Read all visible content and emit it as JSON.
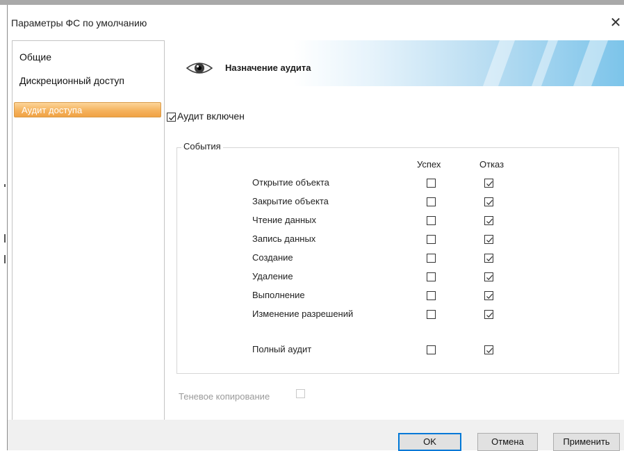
{
  "window": {
    "title": "Параметры ФС по умолчанию",
    "close_symbol": "✕"
  },
  "sidebar": {
    "items": [
      {
        "label": "Общие"
      },
      {
        "label": "Дискреционный доступ"
      },
      {
        "label": "Аудит доступа",
        "selected": true
      }
    ]
  },
  "banner": {
    "title": "Назначение аудита",
    "icon": "eye-icon"
  },
  "audit_enabled": {
    "label": "Аудит включен",
    "checked": true
  },
  "events": {
    "title": "События",
    "columns": {
      "success": "Успех",
      "failure": "Отказ"
    },
    "rows": [
      {
        "label": "Открытие объекта",
        "success": false,
        "failure": true
      },
      {
        "label": "Закрытие объекта",
        "success": false,
        "failure": true
      },
      {
        "label": "Чтение данных",
        "success": false,
        "failure": true
      },
      {
        "label": "Запись данных",
        "success": false,
        "failure": true
      },
      {
        "label": "Создание",
        "success": false,
        "failure": true
      },
      {
        "label": "Удаление",
        "success": false,
        "failure": true
      },
      {
        "label": "Выполнение",
        "success": false,
        "failure": true
      },
      {
        "label": "Изменение разрешений",
        "success": false,
        "failure": true
      }
    ],
    "full_audit": {
      "label": "Полный аудит",
      "success": false,
      "failure": true
    }
  },
  "shadow_copy": {
    "label": "Теневое копирование",
    "checked": false,
    "enabled": false
  },
  "buttons": {
    "ok": "OK",
    "cancel": "Отмена",
    "apply": "Применить"
  },
  "colors": {
    "selection": "#f5b35e",
    "banner_accent": "#7cc4ea",
    "default_button_border": "#0078d7"
  }
}
